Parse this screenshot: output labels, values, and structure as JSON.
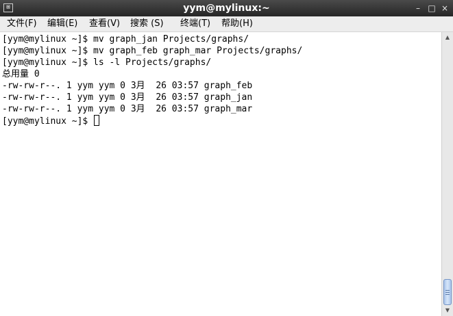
{
  "window": {
    "title": "yym@mylinux:~",
    "icon_glyph": "⊠",
    "controls": {
      "minimize": "–",
      "maximize": "□",
      "close": "×"
    }
  },
  "menu": [
    {
      "label": "文件(F)"
    },
    {
      "label": "编辑(E)"
    },
    {
      "label": "查看(V)"
    },
    {
      "label": "搜索 (S)"
    },
    {
      "label": "终端(T)"
    },
    {
      "label": "帮助(H)"
    }
  ],
  "terminal": {
    "lines": [
      "[yym@mylinux ~]$ mv graph_jan Projects/graphs/",
      "[yym@mylinux ~]$ mv graph_feb graph_mar Projects/graphs/",
      "[yym@mylinux ~]$ ls -l Projects/graphs/",
      "总用量 0",
      "-rw-rw-r--. 1 yym yym 0 3月  26 03:57 graph_feb",
      "-rw-rw-r--. 1 yym yym 0 3月  26 03:57 graph_jan",
      "-rw-rw-r--. 1 yym yym 0 3月  26 03:57 graph_mar"
    ],
    "prompt": "[yym@mylinux ~]$ "
  },
  "scrollbar": {
    "up_arrow": "▲",
    "down_arrow": "▼"
  },
  "colors": {
    "titlebar": "#333333",
    "menubar": "#ededed",
    "terminal_bg": "#ffffff",
    "scroll_thumb": "#b9d0f0"
  }
}
